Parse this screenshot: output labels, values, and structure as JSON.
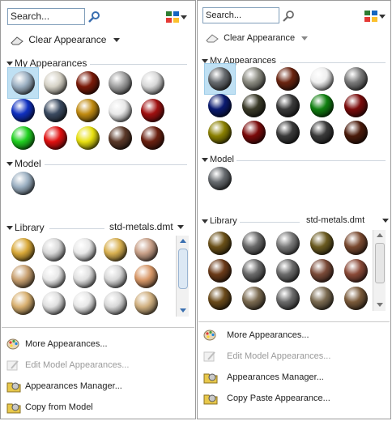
{
  "colors": {
    "selection": "#bfe0f3",
    "accent": "#4a7fc1",
    "disabled": "#9a9a9a"
  },
  "left": {
    "search_placeholder": "Search...",
    "clear_label": "Clear Appearance",
    "my_appearances_title": "My Appearances",
    "model_title": "Model",
    "library_title": "Library",
    "library_file": "std-metals.dmt",
    "my_balls": [
      "#9cb0c2",
      "#d6d2c6",
      "#7a1a08",
      "#a0a0a0",
      "#d8d8d8",
      "#1030c0",
      "#3a4a60",
      "#c08a10",
      "#e8e8e8",
      "#a01010",
      "#20d020",
      "#e01010",
      "#e8e010",
      "#5a3828",
      "#6a2010"
    ],
    "model_balls": [
      "#9cb0c2"
    ],
    "lib_balls": [
      "#d8a838",
      "#d8d8d8",
      "#e8e8e8",
      "#d8b050",
      "#c8a088",
      "#c8a070",
      "#e8e8e8",
      "#e0e0e0",
      "#d8d8d8",
      "#d89868",
      "#d8b070",
      "#e0e0e0",
      "#e8e8e8",
      "#d8d8d8",
      "#d0b080"
    ],
    "menu": [
      {
        "label": "More Appearances...",
        "disabled": false,
        "icon": "palette-icon"
      },
      {
        "label": "Edit Model Appearances...",
        "disabled": true,
        "icon": "edit-palette-icon"
      },
      {
        "label": "Appearances Manager...",
        "disabled": false,
        "icon": "folder-ball-icon"
      },
      {
        "label": "Copy from Model",
        "disabled": false,
        "icon": "folder-ball-icon"
      }
    ]
  },
  "right": {
    "search_placeholder": "Search...",
    "clear_label": "Clear Appearance",
    "my_appearances_title": "My Appearances",
    "model_title": "Model",
    "library_title": "Library",
    "library_file": "std-metals.dmt",
    "my_balls": [
      "#666a6e",
      "#8a8a80",
      "#6a2410",
      "#efefef",
      "#7a7a7a",
      "#0a1a70",
      "#3a3a28",
      "#3a3a3a",
      "#108010",
      "#7a0a0a",
      "#8a8000",
      "#7a0a0a",
      "#3a3a3a",
      "#3a3a3a",
      "#4a1a0a"
    ],
    "model_balls": [
      "#666a6e"
    ],
    "lib_balls": [
      "#6a5018",
      "#6a6a6a",
      "#7a7a7a",
      "#6a5a20",
      "#7a4a30",
      "#6a3a18",
      "#6a6a6a",
      "#6a6a6a",
      "#7a4a38",
      "#8a4a38",
      "#6a4a1a",
      "#7a6a50",
      "#6a6a6a",
      "#7a6a50",
      "#7a5a3a"
    ],
    "menu": [
      {
        "label": "More Appearances...",
        "disabled": false,
        "icon": "palette-icon"
      },
      {
        "label": "Edit Model Appearances...",
        "disabled": true,
        "icon": "edit-palette-icon"
      },
      {
        "label": "Appearances Manager...",
        "disabled": false,
        "icon": "folder-ball-icon"
      },
      {
        "label": "Copy Paste Appearance...",
        "disabled": false,
        "icon": "folder-ball-icon"
      }
    ]
  }
}
